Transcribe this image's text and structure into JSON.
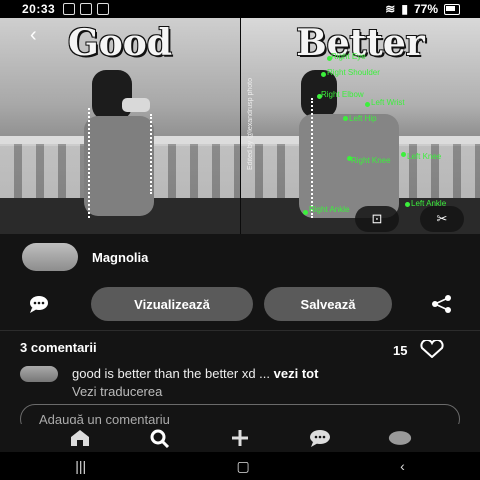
{
  "status_bar": {
    "time": "20:33",
    "battery": "77%"
  },
  "hero": {
    "left_title": "Good",
    "right_title": "Better",
    "watermark": "Edited by @lexandrusp photo",
    "pose_labels": [
      "Right Eye",
      "Right Shoulder",
      "Right Elbow",
      "Left Wrist",
      "Left Hip",
      "Right Knee",
      "Left Knee",
      "Right Ankle",
      "Left Ankle"
    ]
  },
  "profile": {
    "name": "Magnolia"
  },
  "actions": {
    "view_label": "Vizualizează",
    "save_label": "Salvează"
  },
  "comments": {
    "count_label": "3 comentarii",
    "likes": "15",
    "first_comment": "good is better than the better xd ...",
    "see_all": "vezi tot",
    "translate": "Vezi traducerea",
    "add_placeholder": "Adaugă un comentariu"
  },
  "icons": {
    "back": "back-arrow-icon",
    "lens": "lens-icon",
    "scissors": "scissors-icon",
    "comment": "comment-bubble-icon",
    "share": "share-icon",
    "heart": "heart-icon",
    "home": "home-icon",
    "search": "search-icon",
    "create": "plus-icon",
    "messages": "messages-icon",
    "profile": "profile-icon"
  },
  "colors": {
    "pose_green": "#3cf03c",
    "button_gray": "#5a5a5a",
    "background": "#141414"
  }
}
